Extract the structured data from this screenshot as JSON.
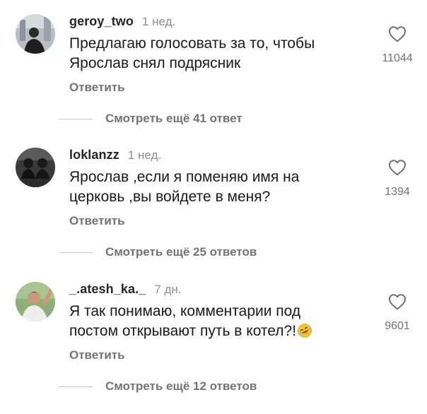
{
  "colors": {
    "text": "#262626",
    "muted": "#737373",
    "line": "#c7c7c7"
  },
  "comments": [
    {
      "username": "geroy_two",
      "time": "1 нед.",
      "text": "Предлагаю голосовать за то, чтобы\nЯрослав снял подрясник",
      "likes": "11044",
      "reply_label": "Ответить",
      "more_label": "Смотреть ещё 41 ответ",
      "like_icon": "heart-outline-icon"
    },
    {
      "username": "loklanzz",
      "time": "1 нед.",
      "text": "Ярослав ,если я поменяю имя на\nцерковь ,вы войдете в меня?",
      "likes": "1394",
      "reply_label": "Ответить",
      "more_label": "Смотреть ещё 25 ответов",
      "like_icon": "heart-outline-icon"
    },
    {
      "username": "_.atesh_ka._",
      "time": "7 дн.",
      "text": "Я так понимаю, комментарии под\nпостом открывают путь в котел?!",
      "emoji": "rolling-on-floor-laughing-emoji",
      "likes": "9601",
      "reply_label": "Ответить",
      "more_label": "Смотреть ещё 12 ответов",
      "like_icon": "heart-outline-icon"
    }
  ]
}
